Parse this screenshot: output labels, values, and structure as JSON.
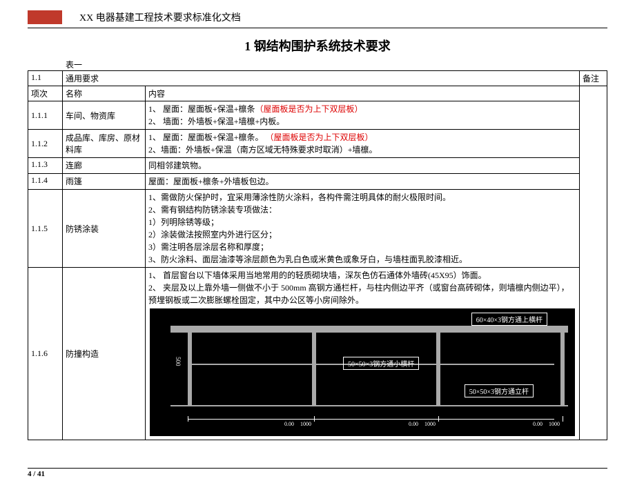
{
  "header": {
    "doc_title": "XX 电器基建工程技术要求标准化文档"
  },
  "section": {
    "number": "1",
    "title": "钢结构围护系统技术要求",
    "table_caption": "表一"
  },
  "table": {
    "head_row": {
      "sec": "1.1",
      "sec_title": "通用要求",
      "note_header": "备注"
    },
    "cols": {
      "idx": "项次",
      "name": "名称",
      "content": "内容"
    },
    "rows": [
      {
        "idx": "1.1.1",
        "name": "车间、物资库",
        "content_lines": [
          {
            "text": "1、 屋面：屋面板+保温+檩条",
            "red": "（屋面板是否为上下双层板）"
          },
          {
            "text": "2、 墙面：外墙板+保温+墙檩+内板。"
          }
        ]
      },
      {
        "idx": "1.1.2",
        "name": "成品库、库房、原材料库",
        "content_lines": [
          {
            "text": "1、 屋面：屋面板+保温+檩条。 ",
            "red": "（屋面板是否为上下双层板）"
          },
          {
            "text": "2、墙面：外墙板+保温（南方区域无特殊要求时取消）+墙檩。"
          }
        ]
      },
      {
        "idx": "1.1.3",
        "name": "连廊",
        "content_lines": [
          {
            "text": "同相邻建筑物。"
          }
        ]
      },
      {
        "idx": "1.1.4",
        "name": "雨篷",
        "content_lines": [
          {
            "text": "屋面：屋面板+檩条+外墙板包边。"
          }
        ]
      },
      {
        "idx": "1.1.5",
        "name": "防锈涂装",
        "content_lines": [
          {
            "text": "1、需做防火保护时，宜采用薄涂性防火涂料，各构件需注明具体的耐火极限时间。"
          },
          {
            "text": "2、需有钢结构防锈涂装专项做法："
          },
          {
            "text": "1）列明除锈等级；"
          },
          {
            "text": "2）涂装做法按照室内外进行区分；"
          },
          {
            "text": "3）需注明各层涂层名称和厚度；"
          },
          {
            "text": "3、防火涂料、面层油漆等涂层颜色为乳白色或米黄色或象牙白，与墙柱面乳胶漆相近。"
          }
        ]
      },
      {
        "idx": "1.1.6",
        "name": "防撞构造",
        "content_lines": [
          {
            "text": "1、 首层窗台以下墙体采用当地常用的的轻质砌块墙，深灰色仿石通体外墙砖(45X95）饰面。"
          },
          {
            "text": "2、 夹层及以上靠外墙一侧做不小于 500mm 高钢方通栏杆，与柱内侧边平齐（或窗台高砖砌体，则墙檩内侧边平），预埋钢板或二次膨胀螺栓固定，其中办公区等小房间除外。"
          }
        ]
      }
    ]
  },
  "diagram": {
    "label_top": "60×40×3钢方通上横杆",
    "label_mid": "50×50×3钢方通小横杆",
    "label_post": "50×50×3钢方通立杆",
    "vdim": "500",
    "dims": [
      "0.00",
      "1000",
      "0.00",
      "1000",
      "0.00",
      "1000"
    ]
  },
  "footer": {
    "page": "4 / 41"
  }
}
